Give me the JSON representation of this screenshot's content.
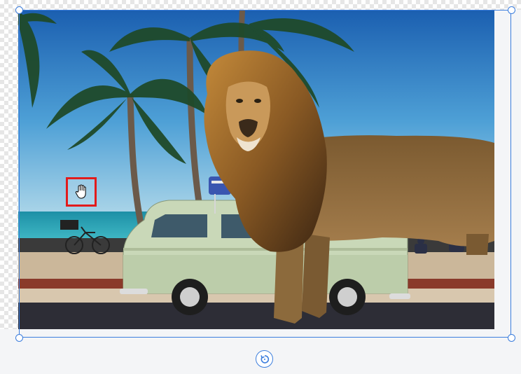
{
  "editor": {
    "selected_object": "lion-on-beach-photo",
    "accent_color": "#3b7ddd",
    "highlight_color": "#e21b1b"
  },
  "icons": {
    "rotate": "rotate-icon",
    "cursor": "hand-cursor-icon"
  }
}
